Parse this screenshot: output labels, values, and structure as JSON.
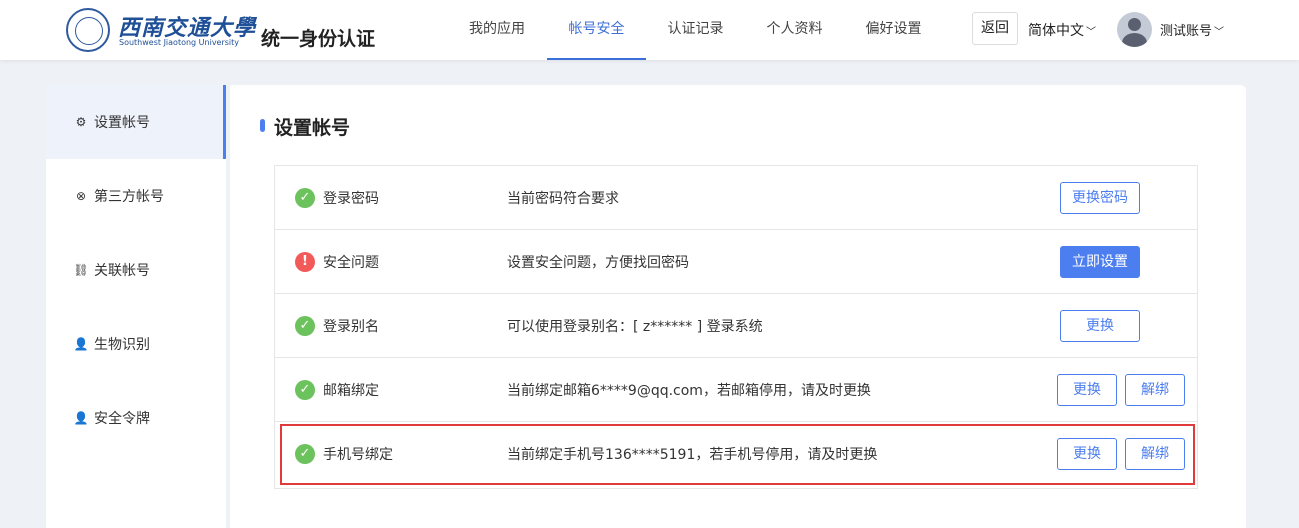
{
  "header": {
    "logo_cn": "西南交通大學",
    "logo_en": "Southwest Jiaotong University",
    "site_title": "统一身份认证",
    "nav": [
      {
        "label": "我的应用",
        "active": false
      },
      {
        "label": "帐号安全",
        "active": true
      },
      {
        "label": "认证记录",
        "active": false
      },
      {
        "label": "个人资料",
        "active": false
      },
      {
        "label": "偏好设置",
        "active": false
      }
    ],
    "back_label": "返回",
    "language": "简体中文",
    "user_name": "测试账号"
  },
  "sidebar": {
    "items": [
      {
        "label": "设置帐号",
        "icon": "gear-icon",
        "active": true
      },
      {
        "label": "第三方帐号",
        "icon": "link-icon",
        "active": false
      },
      {
        "label": "关联帐号",
        "icon": "chain-icon",
        "active": false
      },
      {
        "label": "生物识别",
        "icon": "user-icon",
        "active": false
      },
      {
        "label": "安全令牌",
        "icon": "user-icon",
        "active": false
      }
    ]
  },
  "main": {
    "title": "设置帐号",
    "rows": [
      {
        "status": "ok",
        "label": "登录密码",
        "desc": "当前密码符合要求",
        "buttons": [
          {
            "label": "更换密码",
            "primary": false
          }
        ]
      },
      {
        "status": "warn",
        "label": "安全问题",
        "desc": "设置安全问题，方便找回密码",
        "buttons": [
          {
            "label": "立即设置",
            "primary": true
          }
        ]
      },
      {
        "status": "ok",
        "label": "登录别名",
        "desc": "可以使用登录别名：[ z****** ] 登录系统",
        "buttons": [
          {
            "label": "更换",
            "primary": false
          }
        ]
      },
      {
        "status": "ok",
        "label": "邮箱绑定",
        "desc": "当前绑定邮箱6****9@qq.com，若邮箱停用，请及时更换",
        "buttons": [
          {
            "label": "更换",
            "primary": false
          },
          {
            "label": "解绑",
            "primary": false
          }
        ]
      },
      {
        "status": "ok",
        "label": "手机号绑定",
        "desc": "当前绑定手机号136****5191，若手机号停用，请及时更换",
        "buttons": [
          {
            "label": "更换",
            "primary": false
          },
          {
            "label": "解绑",
            "primary": false
          }
        ]
      }
    ]
  },
  "colors": {
    "accent": "#4d7ef0",
    "ok": "#6cc25c",
    "warn": "#f25a5a",
    "highlight": "#e03a3a"
  }
}
